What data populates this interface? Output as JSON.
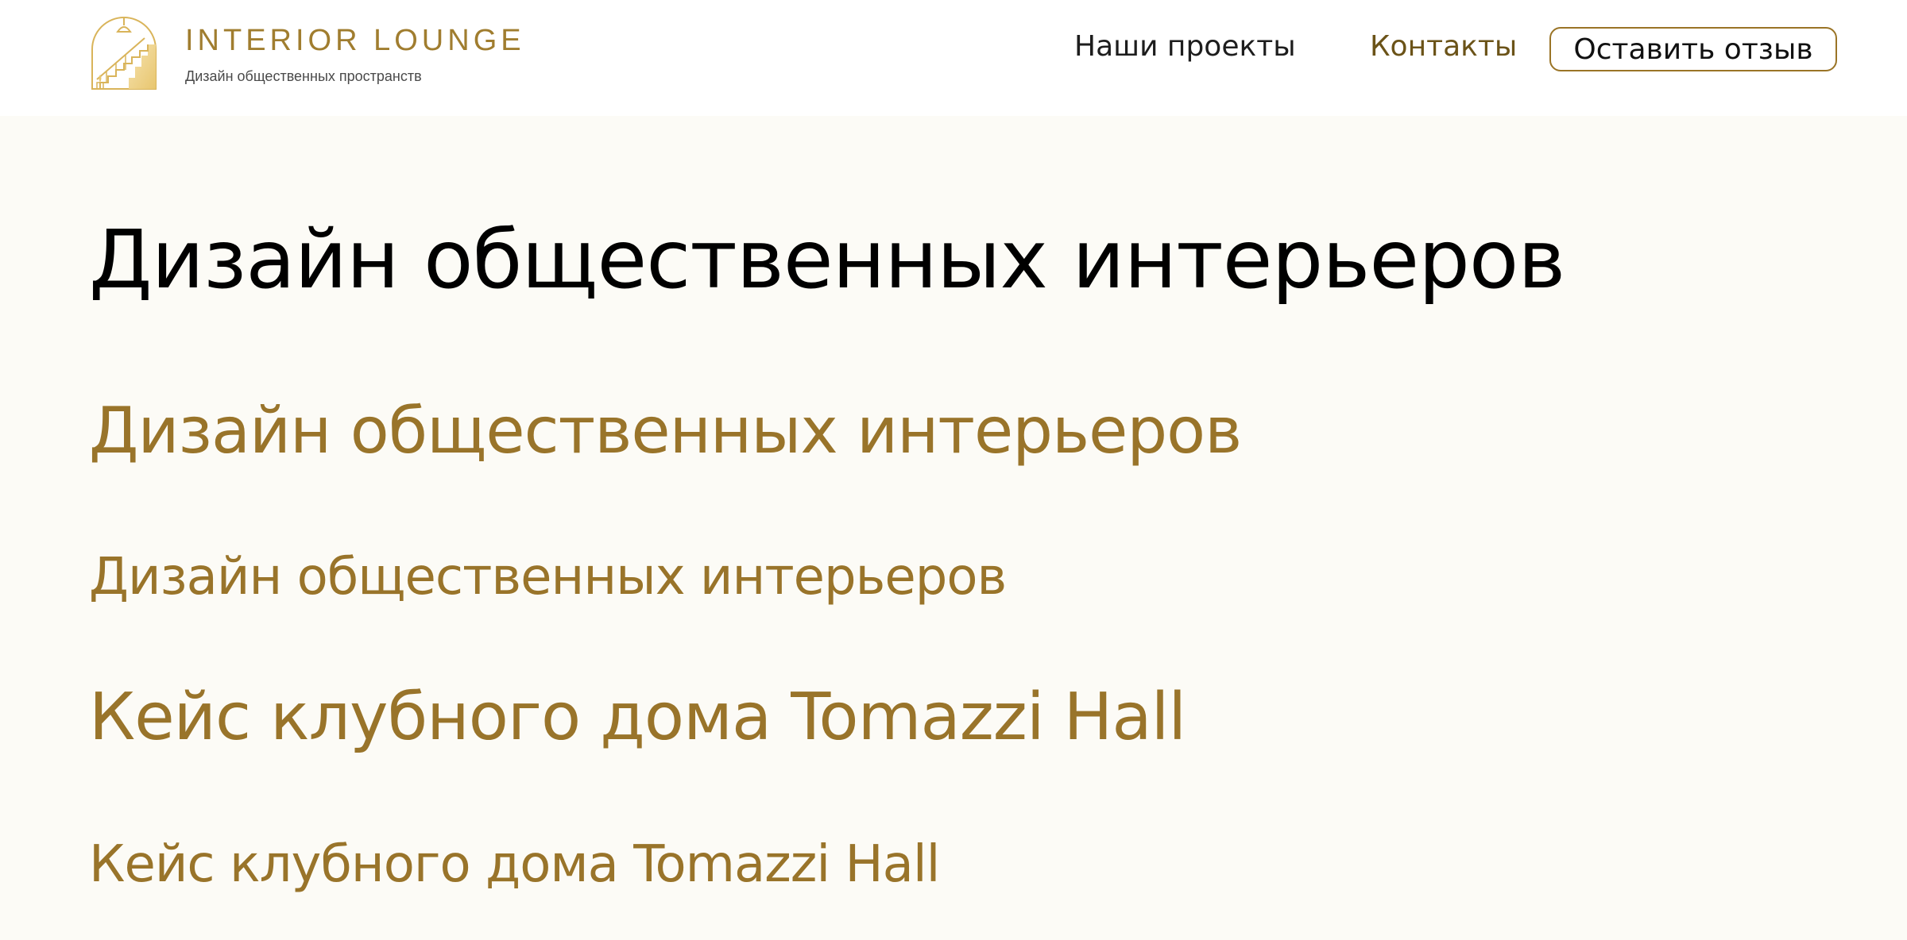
{
  "colors": {
    "page_background": "#fcfbf6",
    "header_background": "#ffffff",
    "accent_gold": "#99742a",
    "nav_active": "#6b5318",
    "text_dark": "#000000"
  },
  "header": {
    "logo_icon": "staircase-arch-logo-icon",
    "brand_name": "INTERIOR LOUNGE",
    "tagline": "Дизайн общественных пространств",
    "nav": {
      "projects_label": "Наши проекты",
      "contacts_label": "Контакты"
    },
    "review_button_label": "Оставить отзыв"
  },
  "main": {
    "heading_1": "Дизайн общественных интерьеров",
    "heading_2": "Дизайн общественных интерьеров",
    "heading_3": "Дизайн общественных интерьеров",
    "heading_4": "Кейс клубного дома Tomazzi Hall",
    "heading_5": "Кейс клубного дома Tomazzi Hall"
  }
}
